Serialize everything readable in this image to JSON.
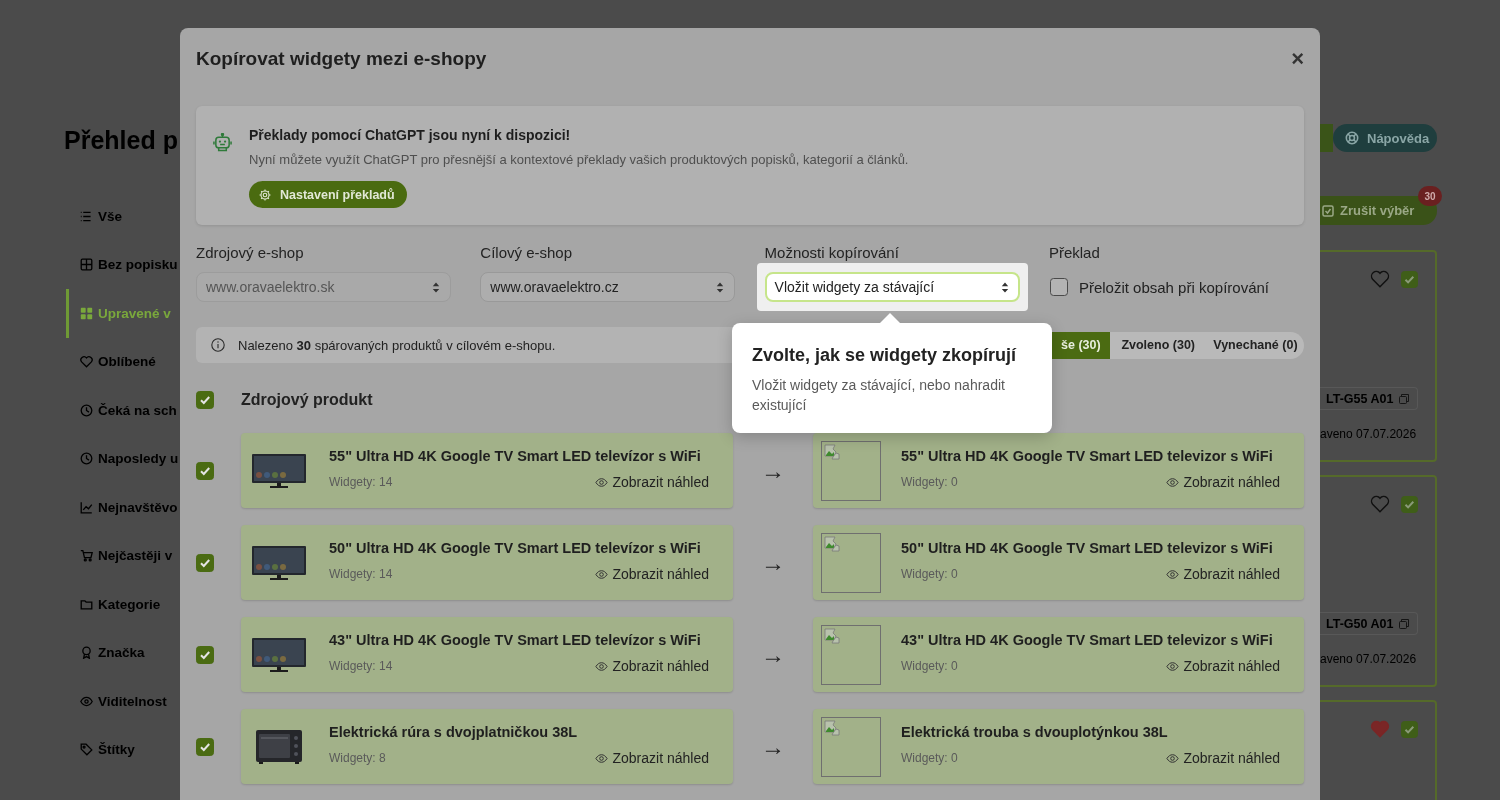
{
  "background_page": {
    "title": "Přehled p",
    "sidebar": {
      "items": [
        {
          "label": "Vše",
          "selected": false
        },
        {
          "label": "Bez popisku",
          "selected": false
        },
        {
          "label": "Upravené v",
          "selected": true
        },
        {
          "label": "Oblíbené",
          "selected": false
        },
        {
          "label": "Čeká na sch",
          "selected": false
        },
        {
          "label": "Naposledy u",
          "selected": false
        },
        {
          "label": "Nejnavštěvo",
          "selected": false
        },
        {
          "label": "Nejčastěji v",
          "selected": false
        },
        {
          "label": "Kategorie",
          "selected": false
        },
        {
          "label": "Značka",
          "selected": false
        },
        {
          "label": "Viditelnost",
          "selected": false
        },
        {
          "label": "Štítky",
          "selected": false
        }
      ]
    },
    "help_button": {
      "label": "Nápověda"
    },
    "clear_selection_button": {
      "label": "Zrušit výběr",
      "badge": "30"
    },
    "product_cards": [
      {
        "favorite": false,
        "checked": true,
        "code": "LT-G55 A01",
        "date": "aveno 07.07.2026"
      },
      {
        "favorite": false,
        "checked": true,
        "code": "LT-G50 A01",
        "date": "aveno 07.07.2026"
      },
      {
        "favorite": true,
        "checked": true
      }
    ]
  },
  "dialog": {
    "title": "Kopírovat widgety mezi e-shopy",
    "close_label": "×",
    "notice": {
      "title": "Překlady pomocí ChatGPT jsou nyní k dispozici!",
      "text": "Nyní můžete využít ChatGPT pro přesnější a kontextové překlady vašich produktových popisků, kategorií a článků.",
      "button": "Nastavení překladů"
    },
    "fields": [
      {
        "kind": "select",
        "label": "Zdrojový e-shop",
        "value": "www.oravaelektro.sk",
        "disabled": true,
        "highlighted": false
      },
      {
        "kind": "select",
        "label": "Cílový e-shop",
        "value": "www.oravaelektro.cz",
        "disabled": false,
        "highlighted": false
      },
      {
        "kind": "select",
        "label": "Možnosti kopírování",
        "value": "Vložit widgety za stávající",
        "disabled": false,
        "highlighted": true
      },
      {
        "kind": "checkbox",
        "label": "Překlad",
        "option": "Přeložit obsah při kopírování",
        "checked": false,
        "disabled": false,
        "highlighted": false
      }
    ],
    "info": "Nalezeno **30** spárovaných produktů v cílovém e-shopu.",
    "filters": [
      {
        "label": "še (30)",
        "selected": true
      },
      {
        "label": "Zvoleno (30)",
        "selected": false
      },
      {
        "label": "Vynechané (0)",
        "selected": false
      }
    ],
    "header": {
      "checked": true,
      "label": "Zdrojový produkt"
    },
    "rows": [
      {
        "checked": true,
        "source": {
          "kind": "tv",
          "title": "55\" Ultra HD 4K Google TV Smart LED televízor s WiFi",
          "widgets": "Widgety: 14",
          "preview": "Zobrazit náhled"
        },
        "arrow": "→",
        "target": {
          "title": "55\" Ultra HD 4K Google TV Smart LED televizor s WiFi",
          "widgets": "Widgety: 0",
          "preview": "Zobrazit náhled"
        }
      },
      {
        "checked": true,
        "source": {
          "kind": "tv",
          "title": "50\" Ultra HD 4K Google TV Smart LED televízor s WiFi",
          "widgets": "Widgety: 14",
          "preview": "Zobrazit náhled"
        },
        "arrow": "→",
        "target": {
          "title": "50\" Ultra HD 4K Google TV Smart LED televizor s WiFi",
          "widgets": "Widgety: 0",
          "preview": "Zobrazit náhled"
        }
      },
      {
        "checked": true,
        "source": {
          "kind": "tv",
          "title": "43\" Ultra HD 4K Google TV Smart LED televízor s WiFi",
          "widgets": "Widgety: 14",
          "preview": "Zobrazit náhled"
        },
        "arrow": "→",
        "target": {
          "title": "43\" Ultra HD 4K Google TV Smart LED televizor s WiFi",
          "widgets": "Widgety: 0",
          "preview": "Zobrazit náhled"
        }
      },
      {
        "checked": true,
        "source": {
          "kind": "oven",
          "title": "Elektrická rúra s dvojplatničkou 38L",
          "widgets": "Widgety: 8",
          "preview": "Zobrazit náhled"
        },
        "arrow": "→",
        "target": {
          "title": "Elektrická trouba s dvouplotýnkou 38L",
          "widgets": "Widgety: 0",
          "preview": "Zobrazit náhled"
        }
      }
    ],
    "tooltip": {
      "title": "Zvolte, jak se widgety zkopírují",
      "text": "Vložit widgety za stávající, nebo nahradit existující"
    }
  }
}
